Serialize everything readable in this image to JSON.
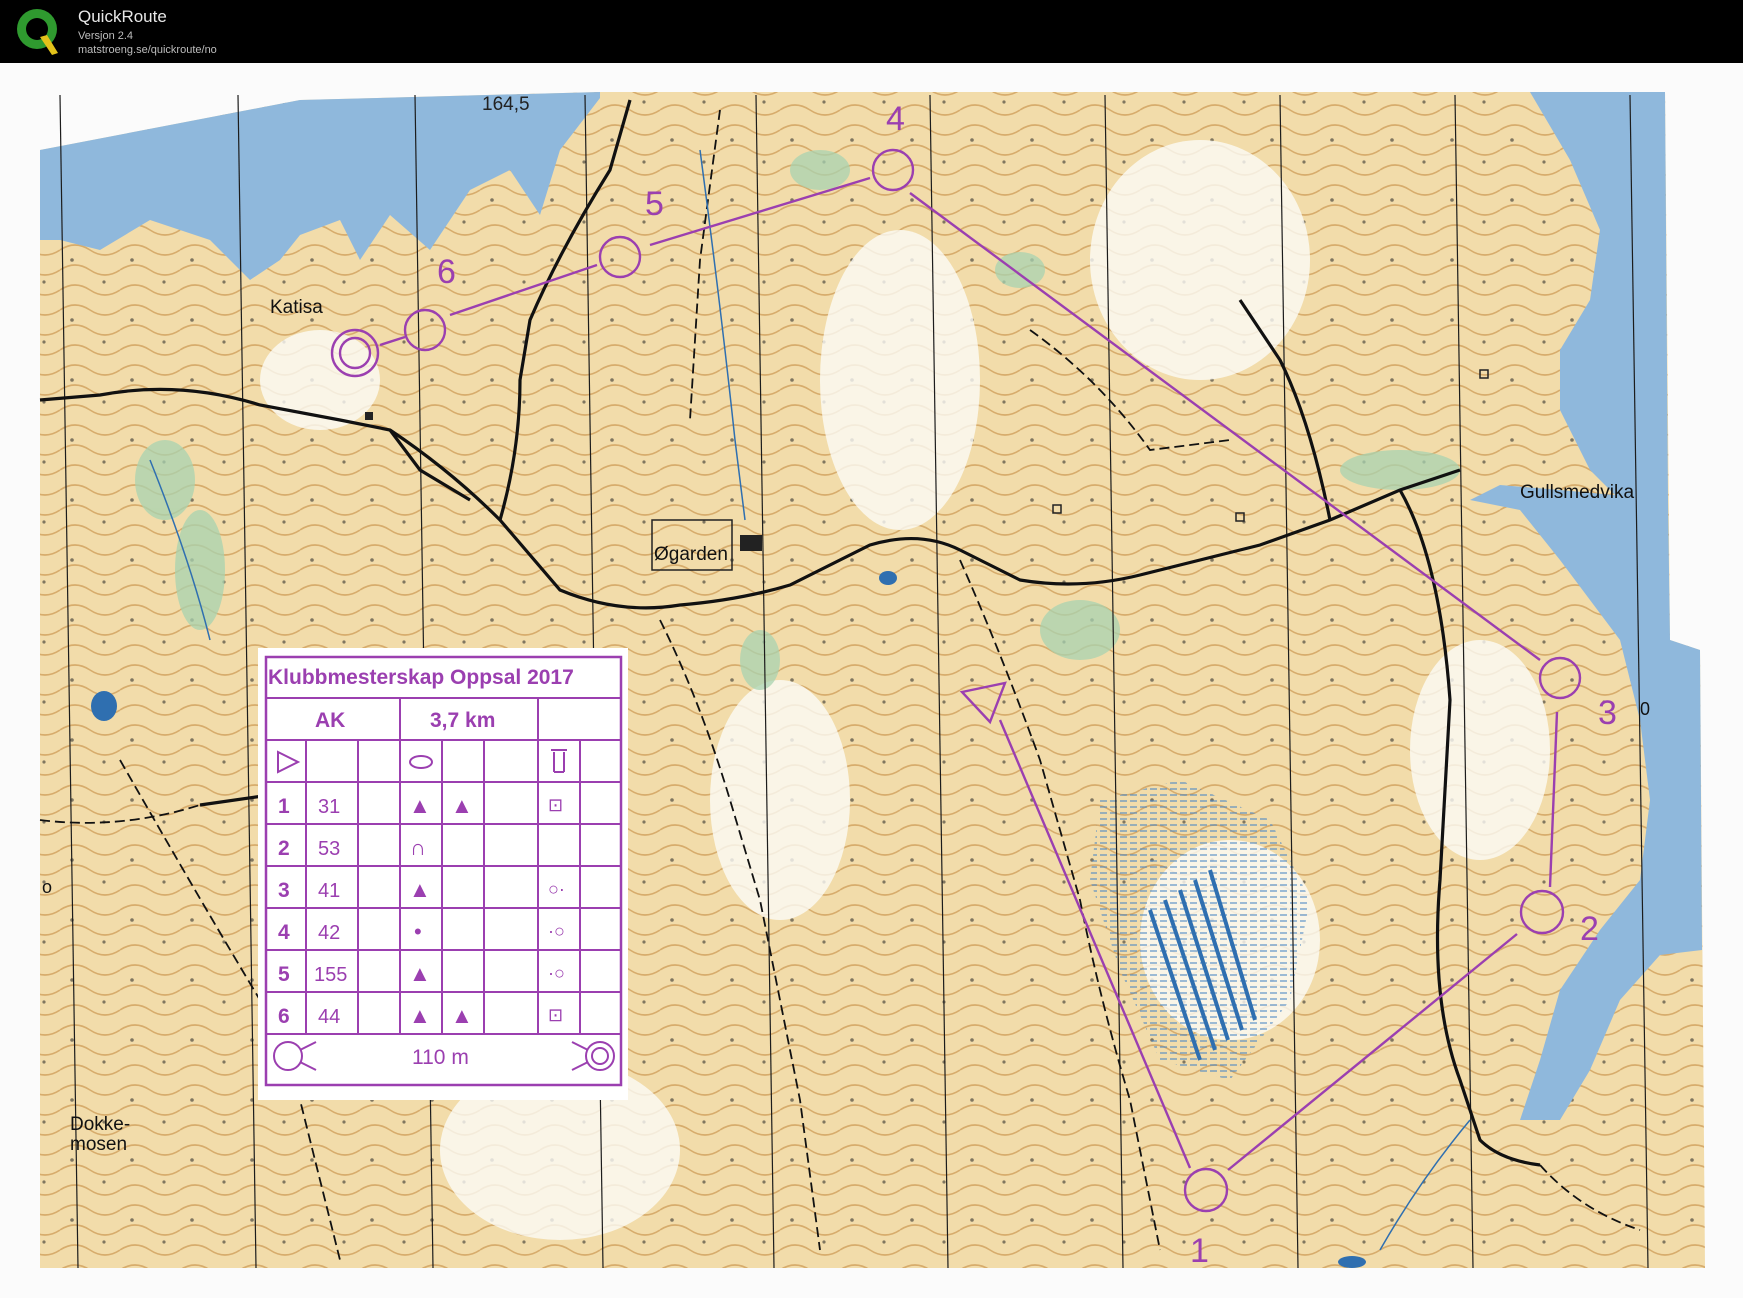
{
  "app": {
    "title": "QuickRoute",
    "version": "Versjon 2.4",
    "url": "matstroeng.se/quickroute/no"
  },
  "map": {
    "height_label": "164,5",
    "place_names": {
      "katisa": "Katisa",
      "ogarden": "Øgarden",
      "gullsmedvika": "Gullsmedvika",
      "dokke_line1": "Dokke-",
      "dokke_line2": "mosen"
    },
    "edge_glyphs": {
      "right": "0",
      "left": "o"
    },
    "control_numbers": [
      "1",
      "2",
      "3",
      "4",
      "5",
      "6"
    ],
    "colors": {
      "course": "#9b3fb0",
      "water": "#8fb8dc",
      "open_land": "#f0d8a0",
      "forest": "#ffffff",
      "green": "#a8d3b0",
      "contour": "#b8782e",
      "road": "#111111"
    }
  },
  "description_sheet": {
    "title": "Klubbmesterskap Oppsal 2017",
    "class": "AK",
    "distance": "3,7 km",
    "rows": [
      {
        "num": "1",
        "code": "31",
        "c3": "▲",
        "c4": "▲",
        "c7": "⊡"
      },
      {
        "num": "2",
        "code": "53",
        "c3": "∩",
        "c4": "",
        "c7": ""
      },
      {
        "num": "3",
        "code": "41",
        "c3": "▲",
        "c4": "",
        "c7": "○·"
      },
      {
        "num": "4",
        "code": "42",
        "c3": "•",
        "c4": "",
        "c7": "·○"
      },
      {
        "num": "5",
        "code": "155",
        "c3": "▲",
        "c4": "",
        "c7": "·○"
      },
      {
        "num": "6",
        "code": "44",
        "c3": "▲",
        "c4": "▲",
        "c7": "⊡"
      }
    ],
    "finish_distance": "110 m"
  }
}
